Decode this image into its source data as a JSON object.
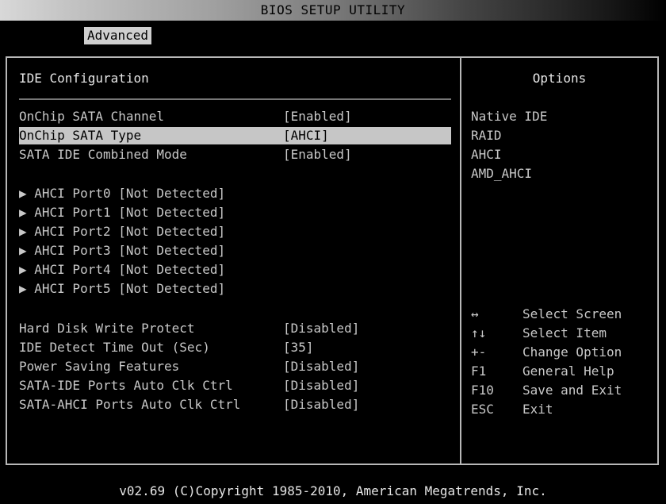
{
  "window": {
    "title": "BIOS SETUP UTILITY"
  },
  "menu": {
    "active_tab": "Advanced"
  },
  "left_panel": {
    "title": "IDE Configuration",
    "items": [
      {
        "label": "OnChip SATA Channel",
        "value": "[Enabled]"
      },
      {
        "label": "OnChip SATA Type",
        "value": "[AHCI]",
        "selected": true
      },
      {
        "label": "SATA IDE Combined Mode",
        "value": "[Enabled]"
      }
    ],
    "ports": [
      {
        "label": "▶ AHCI Port0 [Not Detected]"
      },
      {
        "label": "▶ AHCI Port1 [Not Detected]"
      },
      {
        "label": "▶ AHCI Port2 [Not Detected]"
      },
      {
        "label": "▶ AHCI Port3 [Not Detected]"
      },
      {
        "label": "▶ AHCI Port4 [Not Detected]"
      },
      {
        "label": "▶ AHCI Port5 [Not Detected]"
      }
    ],
    "settings": [
      {
        "label": "Hard Disk Write Protect",
        "value": "[Disabled]"
      },
      {
        "label": "IDE Detect Time Out (Sec)",
        "value": "[35]"
      },
      {
        "label": "Power Saving Features",
        "value": "[Disabled]"
      },
      {
        "label": "SATA-IDE Ports Auto Clk Ctrl",
        "value": "[Disabled]"
      },
      {
        "label": "SATA-AHCI Ports Auto Clk Ctrl",
        "value": "[Disabled]"
      }
    ]
  },
  "right_panel": {
    "title": "Options",
    "options": [
      "Native IDE",
      "RAID",
      "AHCI",
      "AMD_AHCI"
    ],
    "keys": [
      {
        "key": "↔",
        "desc": "Select Screen"
      },
      {
        "key": "↑↓",
        "desc": "Select Item"
      },
      {
        "key": "+-",
        "desc": "Change Option"
      },
      {
        "key": "F1",
        "desc": "General Help"
      },
      {
        "key": "F10",
        "desc": "Save and Exit"
      },
      {
        "key": "ESC",
        "desc": "Exit"
      }
    ]
  },
  "footer": {
    "text": "v02.69 (C)Copyright 1985-2010, American Megatrends, Inc."
  }
}
